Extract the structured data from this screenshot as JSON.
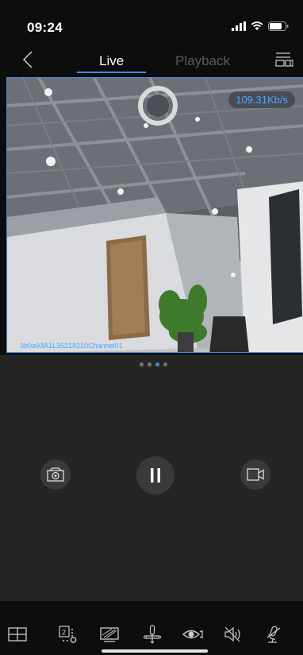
{
  "status_bar": {
    "time": "09:24"
  },
  "nav": {
    "tabs": [
      {
        "label": "Live",
        "active": true
      },
      {
        "label": "Playback",
        "active": false
      }
    ]
  },
  "video": {
    "bitrate": "109.31Kb/s",
    "channel_label": "3b0a93A1L35218210Channel01"
  },
  "pager": {
    "pages": 4,
    "active_index": 2
  },
  "controls": {
    "snapshot_icon": "camera-icon",
    "pause_icon": "pause-icon",
    "record_icon": "video-record-icon"
  },
  "toolbar": {
    "items": [
      "layout-grid-icon",
      "stream-quality-icon",
      "display-mode-icon",
      "ptz-joystick-icon",
      "view-eye-icon",
      "speaker-mute-icon",
      "microphone-mute-icon"
    ]
  },
  "colors": {
    "accent": "#3c8ee0",
    "background": "#0d0d0d",
    "control_panel": "#252525"
  }
}
